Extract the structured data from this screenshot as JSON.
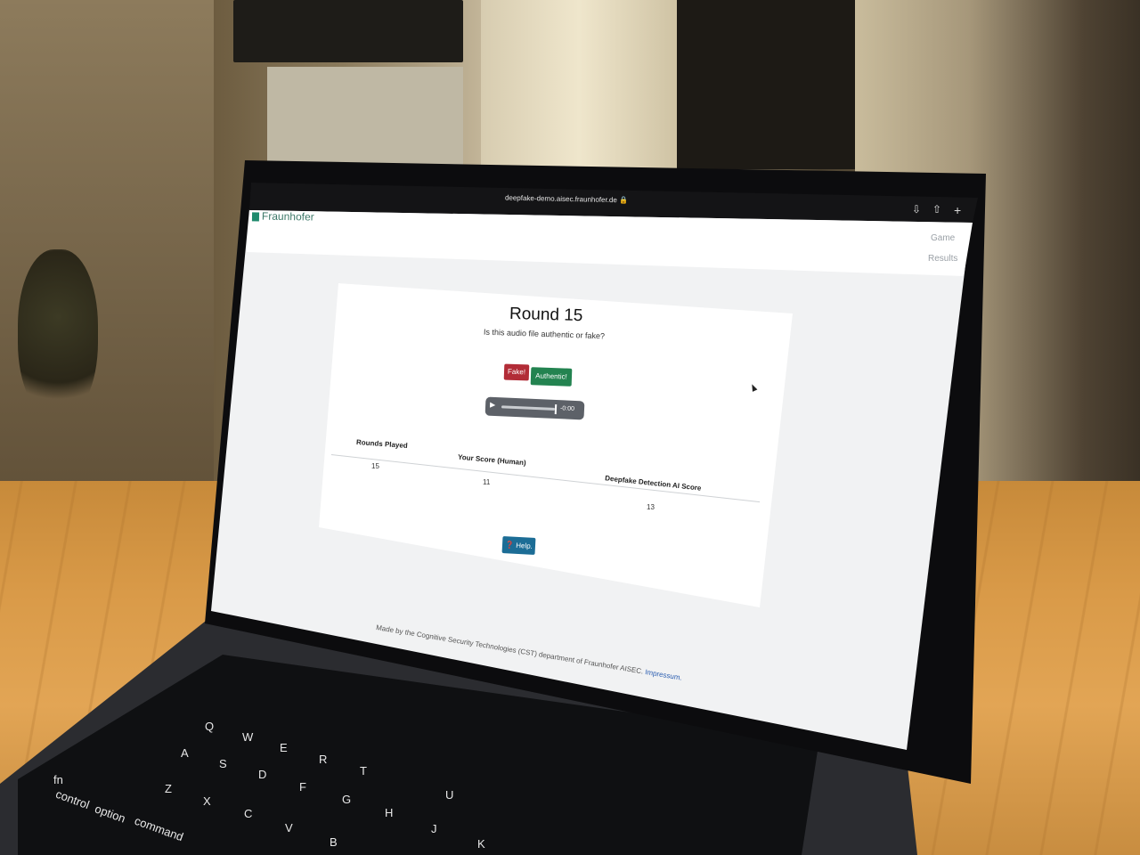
{
  "browser": {
    "url": "deepfake-demo.aisec.fraunhofer.de",
    "lock_icon": "lock-icon",
    "toolbar_icons": [
      "download-icon",
      "share-icon",
      "new-tab-icon"
    ]
  },
  "site": {
    "logo_text": "Fraunhofer",
    "nav": [
      "Game",
      "Results"
    ]
  },
  "game": {
    "title": "Round 15",
    "question": "Is this audio file authentic or fake?",
    "fake_label": "Fake!",
    "authentic_label": "Authentic!",
    "audio_time": "-0:00",
    "help_label": "Help."
  },
  "scoreboard": {
    "headers": [
      "Rounds Played",
      "Your Score (Human)",
      "Deepfake Detection AI Score"
    ],
    "values": [
      "15",
      "11",
      "13"
    ]
  },
  "footer": {
    "text": "Made by the Cognitive Security Technologies (CST) department of Fraunhofer AISEC.",
    "link": "Impressum."
  },
  "keyboard": {
    "keys": [
      "control",
      "option",
      "command",
      "fn",
      "A",
      "S",
      "D",
      "F",
      "G",
      "H",
      "J",
      "K",
      "Z",
      "X",
      "C",
      "V",
      "B",
      "Q",
      "W",
      "E",
      "R",
      "T",
      "U"
    ]
  },
  "colors": {
    "fake": "#b22c37",
    "authentic": "#238350",
    "help": "#1c6d96",
    "table_wood": "#d99a48"
  }
}
